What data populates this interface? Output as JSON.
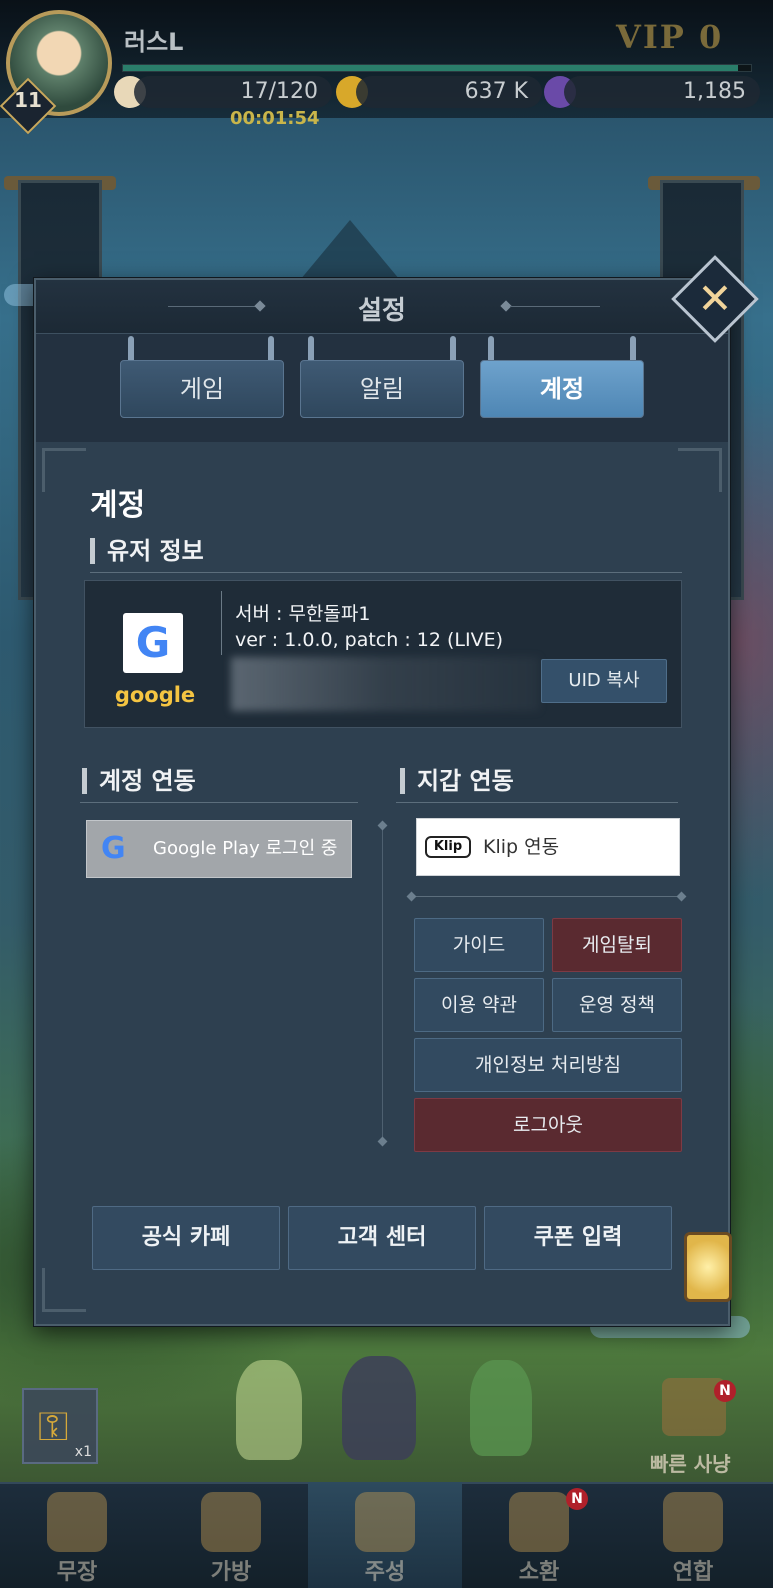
{
  "hud": {
    "player_name": "러스L",
    "level": "11",
    "vip": "VIP 0",
    "exp_progress": 0.98,
    "stamina": "17/120",
    "gold": "637 K",
    "gems": "1,185",
    "timer": "00:01:54"
  },
  "dialog": {
    "title": "설정",
    "tabs": [
      {
        "label": "게임",
        "active": false
      },
      {
        "label": "알림",
        "active": false
      },
      {
        "label": "계정",
        "active": true
      }
    ],
    "section_title": "계정",
    "user_info": {
      "heading": "유저 정보",
      "provider": "google",
      "server": "서버 : 무한돌파1",
      "version": "ver : 1.0.0, patch : 12 (LIVE)",
      "uid_copy_label": "UID 복사"
    },
    "account_link": {
      "heading": "계정 연동",
      "google_button": "Google Play 로그인 중"
    },
    "wallet_link": {
      "heading": "지갑 연동",
      "klip_logo": "Klip",
      "klip_button": "Klip 연동"
    },
    "buttons": {
      "guide": "가이드",
      "withdraw": "게임탈퇴",
      "terms": "이용 약관",
      "policy": "운영 정책",
      "privacy": "개인정보 처리방침",
      "logout": "로그아웃"
    },
    "footer": {
      "cafe": "공식 카페",
      "support": "고객 센터",
      "coupon": "쿠폰 입력"
    }
  },
  "bottom": {
    "quick_hunt": "빠른 사냥",
    "key_count": "x1",
    "nav": [
      {
        "label": "무장",
        "badge": false,
        "active": false
      },
      {
        "label": "가방",
        "badge": false,
        "active": false
      },
      {
        "label": "주성",
        "badge": false,
        "active": true
      },
      {
        "label": "소환",
        "badge": true,
        "active": false
      },
      {
        "label": "연합",
        "badge": false,
        "active": false
      }
    ],
    "badge_text": "N"
  },
  "colors": {
    "tab_active": "#5a92c0",
    "danger": "#5a2a30",
    "google_yellow": "#f5c542"
  }
}
